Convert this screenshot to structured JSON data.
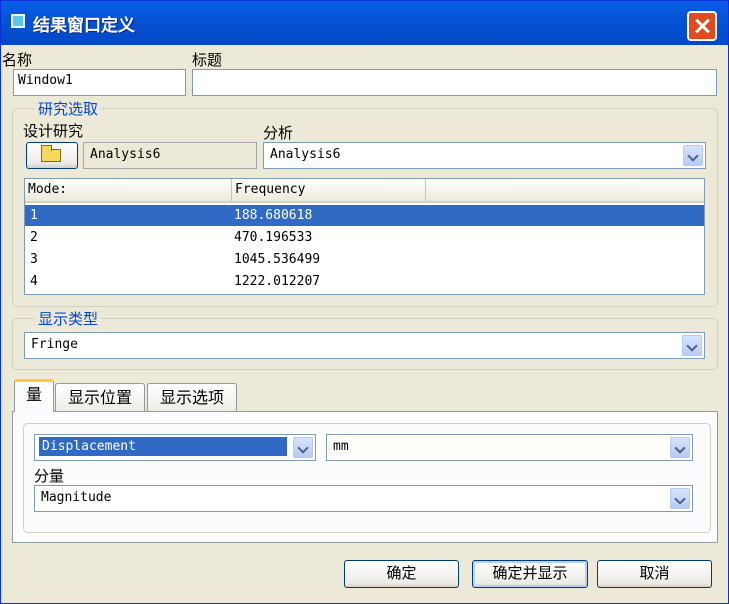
{
  "window": {
    "title": "结果窗口定义"
  },
  "name": {
    "label": "名称",
    "value": "Window1"
  },
  "heading": {
    "label": "标题",
    "value": ""
  },
  "study": {
    "legend": "研究选取",
    "design_label": "设计研究",
    "design_value": "Analysis6",
    "analysis_label": "分析",
    "analysis_value": "Analysis6",
    "columns": [
      "Mode:",
      "Frequency",
      ""
    ],
    "rows": [
      {
        "mode": "1",
        "frequency": "188.680618",
        "selected": true
      },
      {
        "mode": "2",
        "frequency": "470.196533",
        "selected": false
      },
      {
        "mode": "3",
        "frequency": "1045.536499",
        "selected": false
      },
      {
        "mode": "4",
        "frequency": "1222.012207",
        "selected": false
      }
    ]
  },
  "display_type": {
    "legend": "显示类型",
    "value": "Fringe"
  },
  "tabs": [
    {
      "label": "量",
      "active": true
    },
    {
      "label": "显示位置",
      "active": false
    },
    {
      "label": "显示选项",
      "active": false
    }
  ],
  "quantity": {
    "type_value": "Displacement",
    "unit_value": "mm",
    "component_label": "分量",
    "component_value": "Magnitude"
  },
  "buttons": {
    "ok": "确定",
    "ok_show": "确定并显示",
    "cancel": "取消"
  },
  "colors": {
    "titlebar": "#0553D6",
    "selection": "#316AC5",
    "legend_text": "#0046D5",
    "face": "#ECE9D8"
  }
}
